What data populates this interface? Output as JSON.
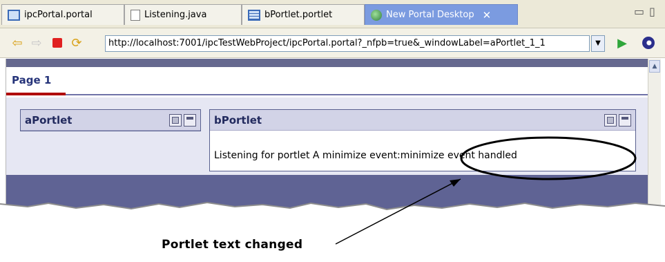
{
  "tabs": [
    {
      "label": "ipcPortal.portal",
      "icon": "portal-file-icon"
    },
    {
      "label": "Listening.java",
      "icon": "java-file-icon"
    },
    {
      "label": "bPortlet.portlet",
      "icon": "portlet-file-icon"
    },
    {
      "label": "New Portal Desktop",
      "icon": "globe-icon",
      "active": true
    }
  ],
  "toolbar": {
    "url": "http://localhost:7001/ipcTestWebProject/ipcPortal.portal?_nfpb=true&_windowLabel=aPortlet_1_1"
  },
  "page": {
    "title": "Page 1"
  },
  "portlets": {
    "a": {
      "title": "aPortlet"
    },
    "b": {
      "title": "bPortlet",
      "text": "Listening for portlet A minimize event:minimize event handled"
    }
  },
  "annotation": {
    "label": "Portlet text changed"
  },
  "colors": {
    "active_tab": "#7b9be0",
    "portal_band": "#5f6394",
    "tab_underline": "#b00000",
    "portlet_header": "#d2d3e7"
  }
}
